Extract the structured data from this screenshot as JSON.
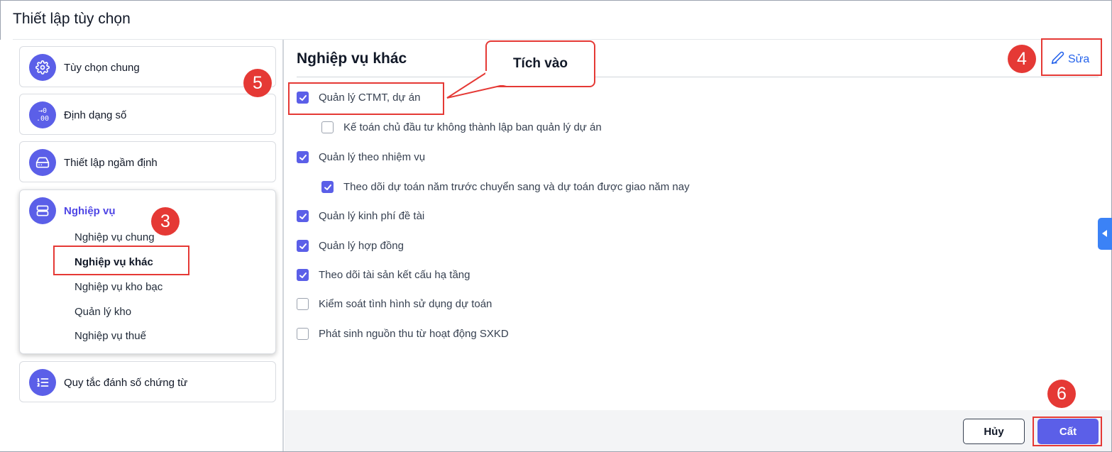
{
  "dialog": {
    "title": "Thiết lập tùy chọn"
  },
  "sidebar": {
    "cards": [
      {
        "label": "Tùy chọn chung",
        "icon": "gear-icon"
      },
      {
        "label": "Định dạng số",
        "icon": "number-format-icon",
        "icon_text_top": "→0",
        "icon_text_bottom": ".00"
      },
      {
        "label": "Thiết lập ngầm định",
        "icon": "drive-icon"
      },
      {
        "label": "Nghiệp vụ",
        "icon": "server-icon",
        "active": true
      },
      {
        "label": "Quy tắc đánh số chứng từ",
        "icon": "numbered-list-icon"
      }
    ],
    "sub_items": [
      {
        "label": "Nghiệp vụ chung"
      },
      {
        "label": "Nghiệp vụ khác",
        "selected": true
      },
      {
        "label": "Nghiệp vụ kho bạc"
      },
      {
        "label": "Quản lý kho"
      },
      {
        "label": "Nghiệp vụ thuế"
      }
    ]
  },
  "main": {
    "title": "Nghiệp vụ khác",
    "edit_label": "Sửa",
    "options": [
      {
        "label": "Quản lý CTMT, dự án",
        "checked": true,
        "indent": false
      },
      {
        "label": "Kế toán chủ đầu tư không thành lập ban quản lý dự án",
        "checked": false,
        "indent": true
      },
      {
        "label": "Quản lý theo nhiệm vụ",
        "checked": true,
        "indent": false
      },
      {
        "label": "Theo dõi dự toán năm trước chuyển sang và dự toán được giao năm nay",
        "checked": true,
        "indent": true
      },
      {
        "label": "Quản lý kinh phí đề tài",
        "checked": true,
        "indent": false
      },
      {
        "label": "Quản lý hợp đồng",
        "checked": true,
        "indent": false
      },
      {
        "label": "Theo dõi tài sản kết cấu hạ tầng",
        "checked": true,
        "indent": false
      },
      {
        "label": "Kiểm soát tình hình sử dụng dự toán",
        "checked": false,
        "indent": false
      },
      {
        "label": "Phát sinh nguồn thu từ hoạt động SXKD",
        "checked": false,
        "indent": false
      }
    ]
  },
  "footer": {
    "cancel_label": "Hủy",
    "save_label": "Cất"
  },
  "annotations": {
    "callout_text": "Tích vào",
    "step_3": "3",
    "step_4": "4",
    "step_5": "5",
    "step_6": "6"
  },
  "colors": {
    "accent": "#5b5fe8",
    "link": "#2563eb",
    "annotation": "#e53935"
  }
}
